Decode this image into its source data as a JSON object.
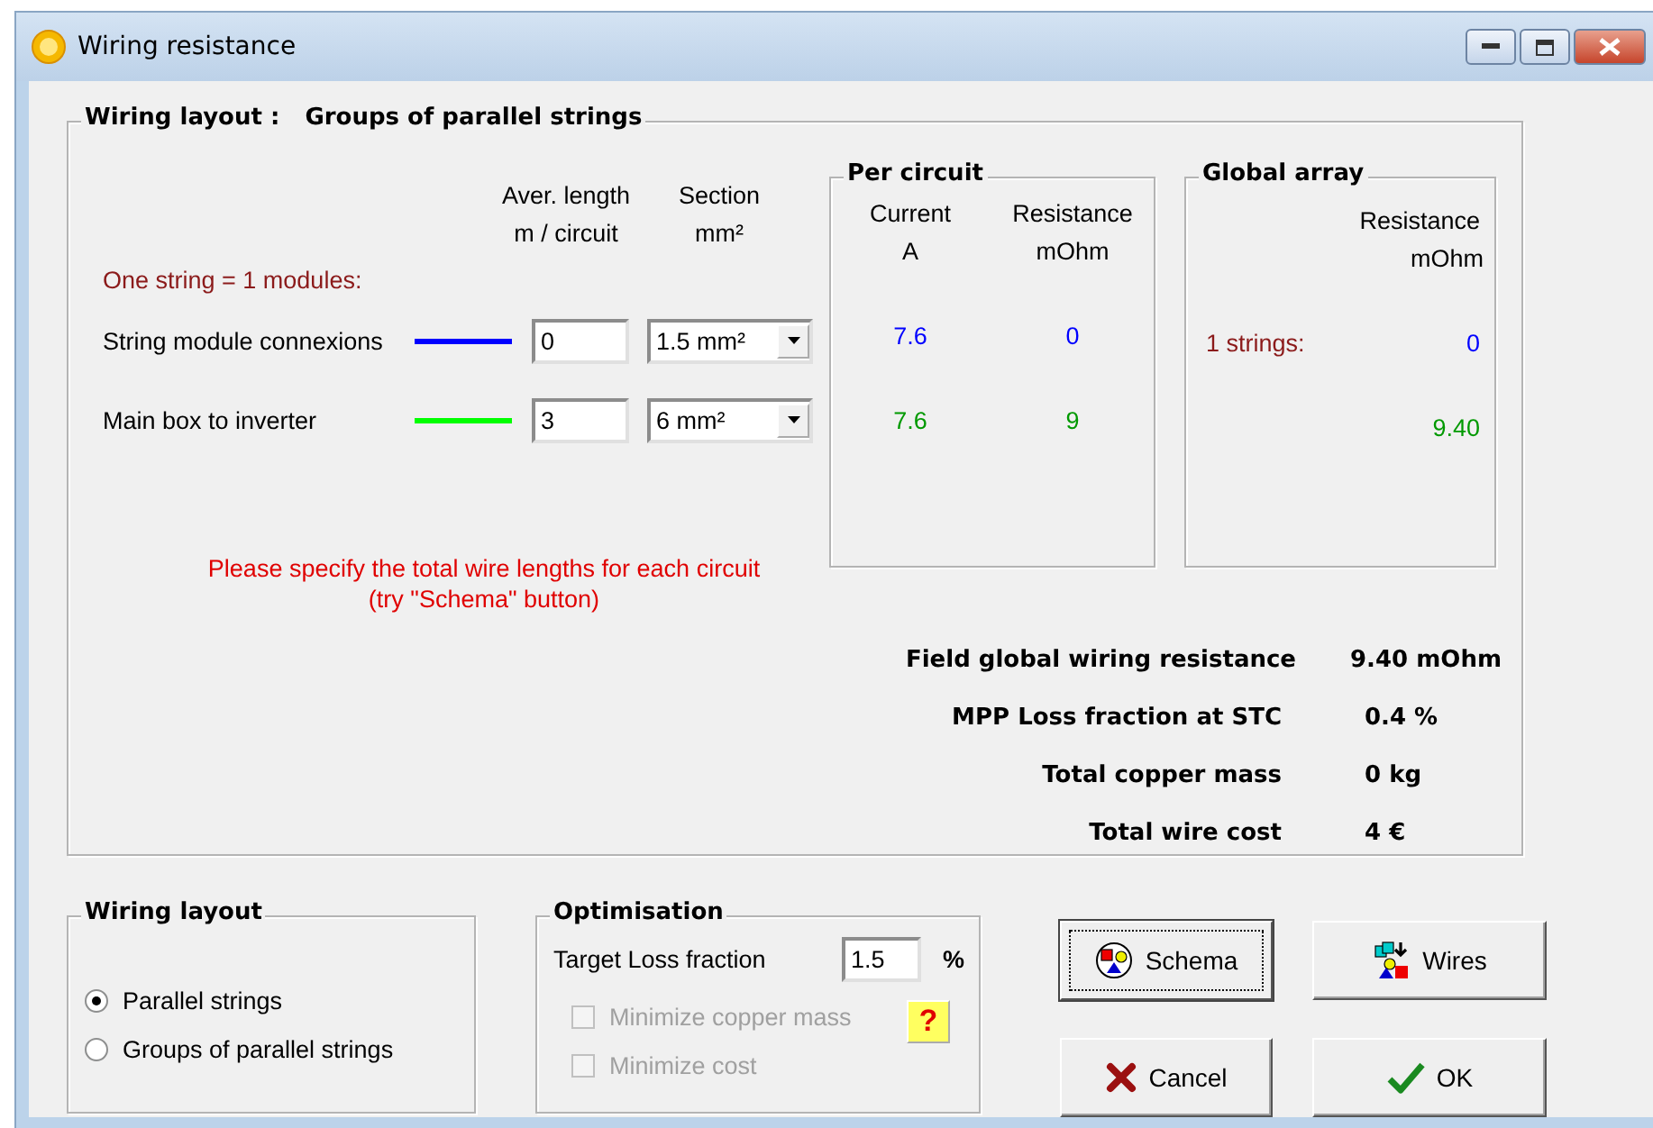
{
  "window": {
    "title": "Wiring resistance"
  },
  "wiring": {
    "title_label": "Wiring layout :",
    "title_value": "Groups of parallel strings",
    "headers": [
      {
        "line1": "Aver. length",
        "line2": "m / circuit"
      },
      {
        "line1": "Section",
        "line2": "mm²"
      }
    ],
    "string_note": "One string =  1 modules:",
    "circuits": [
      {
        "name": "String module connexions",
        "color": "#0000ff",
        "length": "0",
        "section": "1.5 mm²",
        "current": "7.6",
        "resistance": "0",
        "global_label": "1 strings:",
        "global_resistance": "0"
      },
      {
        "name": "Main box to inverter",
        "color": "#00ff00",
        "length": "3",
        "section": "6 mm²",
        "current": "7.6",
        "resistance": "9",
        "global_resistance": "9.40"
      }
    ],
    "message": [
      "Please specify the total wire lengths for each circuit",
      "(try  \"Schema\" button)"
    ],
    "per_circuit": {
      "title": "Per circuit",
      "headers": [
        {
          "line1": "Current",
          "line2": "A"
        },
        {
          "line1": "Resistance",
          "line2": "mOhm"
        }
      ]
    },
    "global_array": {
      "title": "Global array",
      "header": {
        "line1": "Resistance",
        "line2": "mOhm"
      }
    },
    "summary": [
      {
        "label": "Field global wiring resistance",
        "value": "9.40 mOhm"
      },
      {
        "label": "MPP Loss fraction at  STC",
        "value": "0.4 %"
      },
      {
        "label": "Total copper mass",
        "value": "0 kg"
      },
      {
        "label": "Total wire cost",
        "value": "4 €"
      }
    ]
  },
  "layout_group": {
    "title": "Wiring layout",
    "options": [
      {
        "label": "Parallel strings",
        "selected": true
      },
      {
        "label": "Groups of parallel strings",
        "selected": false
      }
    ]
  },
  "optimisation": {
    "title": "Optimisation",
    "target_label": "Target Loss fraction",
    "target_value": "1.5",
    "unit": "%",
    "checkboxes": [
      {
        "label": "Minimize copper mass",
        "checked": false,
        "disabled": true
      },
      {
        "label": "Minimize cost",
        "checked": false,
        "disabled": true
      }
    ],
    "help": "?"
  },
  "buttons": [
    {
      "kind": "schema",
      "label": "Schema",
      "focused": true
    },
    {
      "kind": "wires",
      "label": "Wires",
      "focused": false
    },
    {
      "kind": "cancel",
      "label": "Cancel",
      "focused": false
    },
    {
      "kind": "ok",
      "label": "OK",
      "focused": false
    }
  ]
}
